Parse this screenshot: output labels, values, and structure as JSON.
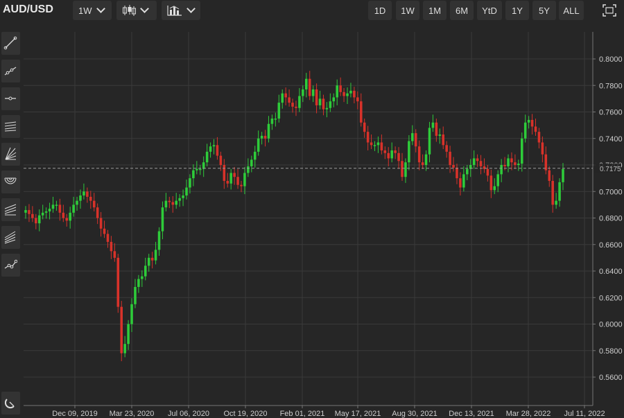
{
  "header": {
    "symbol": "AUD/USD",
    "interval": "1W",
    "chart_style_icon": "candlestick-icon",
    "indicator_icon": "bar-chart-icon",
    "ranges": [
      "1D",
      "1W",
      "1M",
      "6M",
      "YtD",
      "1Y",
      "5Y",
      "ALL"
    ],
    "fullscreen_icon": "fullscreen-icon"
  },
  "toolbar": {
    "tools": [
      "trend-line-icon",
      "ray-icon",
      "horizontal-line-icon",
      "parallel-channel-icon",
      "fib-fan-icon",
      "fib-arc-icon",
      "regression-channel-icon",
      "pitchfork-icon",
      "polyline-icon",
      "magnet-icon"
    ]
  },
  "colors": {
    "up": "#2ecc3a",
    "down": "#d8322a",
    "background": "#262626",
    "grid": "#3a3a3a"
  },
  "chart_data": {
    "type": "candlestick",
    "y_ticks": [
      "0.5600",
      "0.5800",
      "0.6000",
      "0.6200",
      "0.6400",
      "0.6600",
      "0.6800",
      "0.7000",
      "0.7200",
      "0.7400",
      "0.7600",
      "0.7800",
      "0.8000"
    ],
    "x_ticks": [
      "Dec 09, 2019",
      "Mar 23, 2020",
      "Jul 06, 2020",
      "Oct 19, 2020",
      "Feb 01, 2021",
      "May 17, 2021",
      "Aug 30, 2021",
      "Dec 13, 2021",
      "Mar 28, 2022",
      "Jul 11, 2022"
    ],
    "ylim": [
      0.55,
      0.81
    ],
    "last_price": "0.7175",
    "grid": true,
    "closes": [
      0.686,
      0.683,
      0.68,
      0.676,
      0.682,
      0.684,
      0.685,
      0.687,
      0.69,
      0.69,
      0.684,
      0.68,
      0.678,
      0.684,
      0.69,
      0.693,
      0.697,
      0.7,
      0.696,
      0.693,
      0.688,
      0.68,
      0.672,
      0.668,
      0.662,
      0.655,
      0.65,
      0.613,
      0.578,
      0.585,
      0.6,
      0.615,
      0.628,
      0.634,
      0.636,
      0.644,
      0.65,
      0.648,
      0.656,
      0.67,
      0.688,
      0.693,
      0.692,
      0.69,
      0.693,
      0.695,
      0.697,
      0.703,
      0.71,
      0.716,
      0.717,
      0.717,
      0.722,
      0.73,
      0.734,
      0.735,
      0.727,
      0.72,
      0.708,
      0.706,
      0.714,
      0.711,
      0.705,
      0.704,
      0.714,
      0.719,
      0.724,
      0.73,
      0.74,
      0.742,
      0.74,
      0.751,
      0.755,
      0.755,
      0.767,
      0.774,
      0.771,
      0.767,
      0.764,
      0.763,
      0.772,
      0.777,
      0.785,
      0.772,
      0.777,
      0.765,
      0.77,
      0.762,
      0.763,
      0.768,
      0.771,
      0.78,
      0.775,
      0.772,
      0.774,
      0.776,
      0.771,
      0.768,
      0.752,
      0.745,
      0.737,
      0.735,
      0.735,
      0.737,
      0.731,
      0.729,
      0.725,
      0.731,
      0.729,
      0.723,
      0.711,
      0.722,
      0.738,
      0.744,
      0.734,
      0.722,
      0.72,
      0.728,
      0.748,
      0.752,
      0.742,
      0.743,
      0.735,
      0.73,
      0.72,
      0.718,
      0.71,
      0.703,
      0.713,
      0.717,
      0.72,
      0.725,
      0.723,
      0.719,
      0.717,
      0.712,
      0.701,
      0.704,
      0.713,
      0.72,
      0.719,
      0.725,
      0.722,
      0.72,
      0.721,
      0.74,
      0.752,
      0.754,
      0.749,
      0.745,
      0.737,
      0.728,
      0.716,
      0.708,
      0.69,
      0.693,
      0.707,
      0.717
    ]
  }
}
